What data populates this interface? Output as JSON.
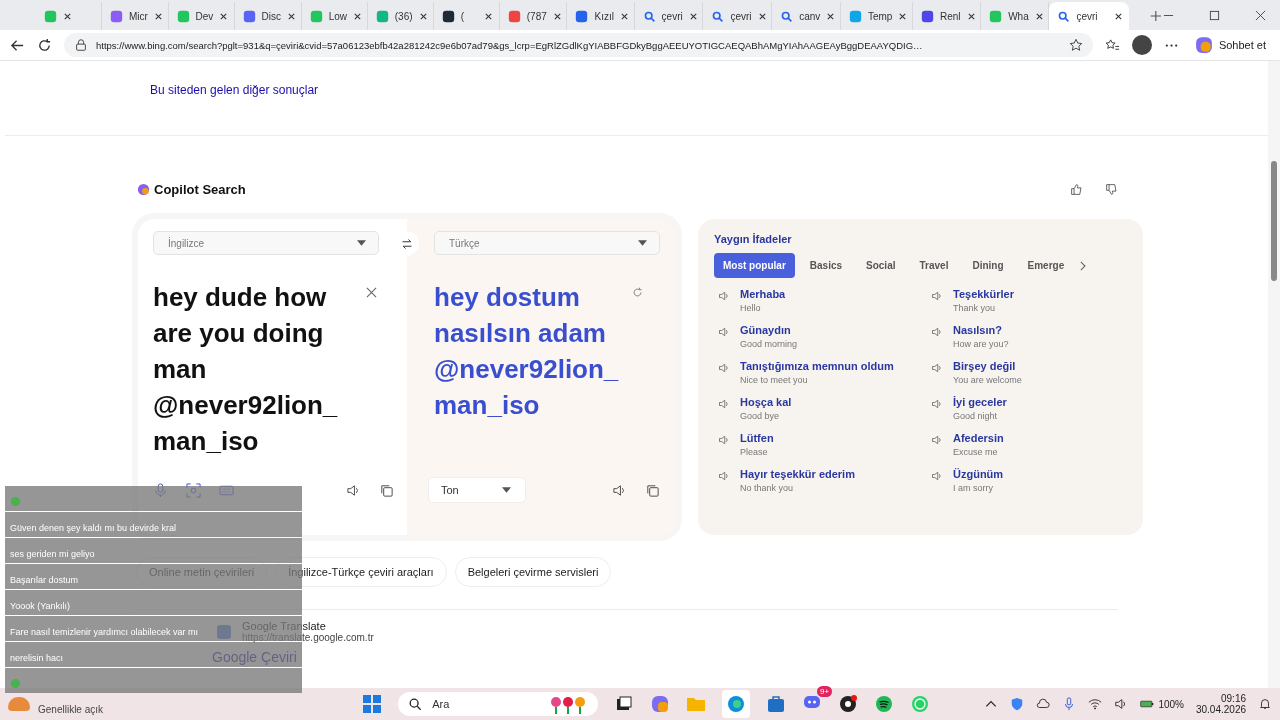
{
  "tabs": [
    {
      "selected": false,
      "kind": "site"
    },
    {
      "label": "Micr",
      "selected": false,
      "kind": "site"
    },
    {
      "label": "Dev",
      "selected": false,
      "kind": "site"
    },
    {
      "label": "Disc",
      "selected": false,
      "kind": "site"
    },
    {
      "label": "Low",
      "selected": false,
      "kind": "site"
    },
    {
      "label": "(36)",
      "selected": false,
      "kind": "site"
    },
    {
      "label": "(",
      "selected": false,
      "kind": "site"
    },
    {
      "label": "(787",
      "selected": false,
      "kind": "site"
    },
    {
      "label": "Kızıl",
      "selected": false,
      "kind": "site"
    },
    {
      "label": "çevri",
      "selected": false,
      "kind": "search"
    },
    {
      "label": "çevri",
      "selected": false,
      "kind": "search"
    },
    {
      "label": "canv",
      "selected": false,
      "kind": "search"
    },
    {
      "label": "Temp",
      "selected": false,
      "kind": "site"
    },
    {
      "label": "Renl",
      "selected": false,
      "kind": "site"
    },
    {
      "label": "Wha",
      "selected": false,
      "kind": "site"
    },
    {
      "label": "çevri",
      "selected": true,
      "kind": "search"
    }
  ],
  "address": {
    "url": "https://www.bing.com/search?pglt=931&q=çeviri&cvid=57a06123ebfb42a281242c9e6b07ad79&gs_lcrp=EgRlZGdlKgYIABBFGDkyBggAEEUYOTIGCAEQABhAMgYIAhAAGEAyBggDEAAYQDIG…",
    "copilot_label": "Sohbet et"
  },
  "more_results_link": "Bu siteden gelen diğer sonuçlar",
  "copilot": {
    "title": "Copilot Search"
  },
  "translator": {
    "source_language": "İngilizce",
    "target_language": "Türkçe",
    "source_text": "hey dude how are you doing man @never92lion_man_iso",
    "translated_text": "hey dostum nasılsın adam @never92lion_man_iso",
    "tone": "Ton"
  },
  "phrases": {
    "title": "Yaygın İfadeler",
    "categories": [
      {
        "label": "Most popular",
        "selected": true
      },
      {
        "label": "Basics",
        "selected": false
      },
      {
        "label": "Social",
        "selected": false
      },
      {
        "label": "Travel",
        "selected": false
      },
      {
        "label": "Dining",
        "selected": false
      },
      {
        "label": "Emerge",
        "selected": false
      }
    ],
    "items": [
      {
        "phrase": "Merhaba",
        "meaning": "Hello"
      },
      {
        "phrase": "Teşekkürler",
        "meaning": "Thank you"
      },
      {
        "phrase": "Günaydın",
        "meaning": "Good morning"
      },
      {
        "phrase": "Nasılsın?",
        "meaning": "How are you?"
      },
      {
        "phrase": "Tanıştığımıza memnun oldum",
        "meaning": "Nice to meet you"
      },
      {
        "phrase": "Birşey değil",
        "meaning": "You are welcome"
      },
      {
        "phrase": "Hoşça kal",
        "meaning": "Good bye"
      },
      {
        "phrase": "İyi geceler",
        "meaning": "Good night"
      },
      {
        "phrase": "Lütfen",
        "meaning": "Please"
      },
      {
        "phrase": "Afedersin",
        "meaning": "Excuse me"
      },
      {
        "phrase": "Hayır teşekkür ederim",
        "meaning": "No thank you"
      },
      {
        "phrase": "Üzgünüm",
        "meaning": "I am sorry"
      }
    ]
  },
  "related_chips": [
    "Online metin çevirileri",
    "İngilizce-Türkçe çeviri araçları",
    "Belgeleri çevirme servisleri"
  ],
  "result": {
    "site_name": "Google Translate",
    "url": "https://translate.google.com.tr",
    "title": "Google Çeviri"
  },
  "chat": [
    {
      "kind": "emoji"
    },
    {
      "kind": "text",
      "text": "Güven denen şey kaldı mı bu devirde kral"
    },
    {
      "kind": "text",
      "text": "ses geriden mi geliyo"
    },
    {
      "kind": "text",
      "text": "Başarılar dostum"
    },
    {
      "kind": "text",
      "text": "Yoook (Yankılı)"
    },
    {
      "kind": "text",
      "text": "Fare nasıl temizlenir yardımcı olabilecek var mı"
    },
    {
      "kind": "text",
      "text": "nerelisin hacı"
    },
    {
      "kind": "emoji"
    }
  ],
  "taskbar": {
    "weather": "Genellikle açık",
    "search_placeholder": "Ara",
    "notification_badge": "9+",
    "battery": "100%",
    "time": "09:16",
    "date": "30.04.2026"
  }
}
